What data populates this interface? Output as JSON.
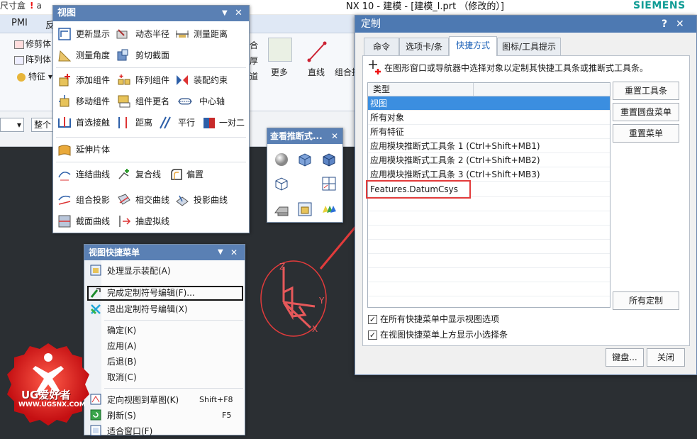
{
  "app": {
    "title": "NX 10 - 建模 - [建模_l.prt （修改的）]",
    "brand": "SIEMENS",
    "qat_left": "尺寸盒",
    "qat_warn": "!",
    "qat_item": "a"
  },
  "ribbon": {
    "tabs": [
      "PMI",
      "反"
    ],
    "trim_label": "修剪体",
    "pattern_label": "阵列体",
    "feature_label": "特征",
    "more_label": "更多",
    "line_label": "直线",
    "combine_label": "组合投",
    "frag_1": "合",
    "frag_2": "厚",
    "frag_3": "道",
    "frag_4": "查"
  },
  "cmdbar": {
    "select_1": "",
    "select_2": "整个装"
  },
  "view_panel": {
    "title": "视图",
    "items": {
      "refresh": "更新显示",
      "dyn_radius": "动态半径",
      "measure_dist": "测量距离",
      "measure_angle": "测量角度",
      "clip_section": "剪切截面",
      "add_component": "添加组件",
      "pattern_component": "阵列组件",
      "assembly_constraint": "装配约束",
      "move_component": "移动组件",
      "rename_component": "组件更名",
      "center_axis": "中心轴",
      "prefer_touch": "首选接触",
      "distance": "距离",
      "parallel": "平行",
      "one_to_two": "一对二",
      "extend_sheet": "延伸片体",
      "connect_curve": "连结曲线",
      "composite_line": "复合线",
      "offset": "偏置",
      "combine_project": "组合投影",
      "intersect_curve": "相交曲线",
      "project_curve": "投影曲线",
      "section_curve": "截面曲线",
      "virtual_line": "抽虚拟线"
    }
  },
  "infer_panel": {
    "title": "查看推断式..."
  },
  "view_menu": {
    "title": "视图快捷菜单",
    "items": [
      {
        "label": "处理显示装配(A)",
        "shortcut": ""
      },
      {
        "label": "完成定制符号编辑(F)...",
        "shortcut": ""
      },
      {
        "label": "退出定制符号编辑(X)",
        "shortcut": ""
      },
      {
        "label": "确定(K)",
        "shortcut": ""
      },
      {
        "label": "应用(A)",
        "shortcut": ""
      },
      {
        "label": "后退(B)",
        "shortcut": ""
      },
      {
        "label": "取消(C)",
        "shortcut": ""
      },
      {
        "label": "定向视图到草图(K)",
        "shortcut": "Shift+F8"
      },
      {
        "label": "刷新(S)",
        "shortcut": "F5"
      },
      {
        "label": "适合窗口(F)",
        "shortcut": ""
      }
    ]
  },
  "dialog": {
    "title": "定制",
    "help": "?",
    "close": "✕",
    "tabs": [
      "命令",
      "选项卡/条",
      "快捷方式",
      "图标/工具提示"
    ],
    "active_tab": 2,
    "instruction": "在图形窗口或导航器中选择对象以定制其快捷工具条或推断式工具条。",
    "list_header": "类型",
    "list_items": [
      "视图",
      "所有对象",
      "所有特征",
      "应用模块推断式工具条 1 (Ctrl+Shift+MB1)",
      "应用模块推断式工具条 2 (Ctrl+Shift+MB2)",
      "应用模块推断式工具条 3 (Ctrl+Shift+MB3)",
      "Features.DatumCsys"
    ],
    "selected_index": 0,
    "buttons": {
      "reset_toolbar": "重置工具条",
      "reset_radial": "重置圆盘菜单",
      "reset_menu": "重置菜单",
      "all_custom": "所有定制",
      "keyboard": "键盘...",
      "close": "关闭"
    },
    "checkboxes": [
      {
        "label": "在所有快捷菜单中显示视图选项",
        "checked": true
      },
      {
        "label": "在视图快捷菜单上方显示小选择条",
        "checked": true
      }
    ]
  },
  "csys_labels": {
    "z": "Z",
    "y": "Y",
    "x": "X"
  },
  "logo": {
    "name": "UG爱好者",
    "url": "WWW.UGSNX.COM"
  },
  "colors": {
    "panel_header": "#5a80b4",
    "dialog_header": "#4d79b2",
    "selection": "#3b8ee0",
    "annotation": "#e23b3b",
    "brand": "#0f9c95"
  }
}
